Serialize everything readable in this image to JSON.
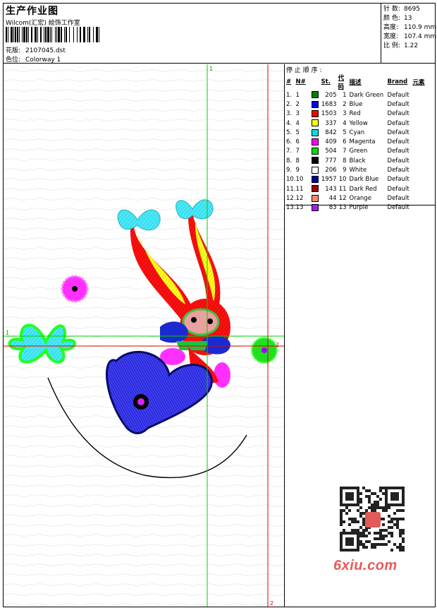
{
  "header": {
    "title": "生产作业图",
    "company": "Wilcom(汇宏) 絵饰工作室",
    "file_label": "花版:",
    "file_name": "2107045.dst",
    "colorway_label": "色位:",
    "colorway_name": "Colorway 1"
  },
  "stats": [
    {
      "label": "针 数:",
      "value": "8695"
    },
    {
      "label": "颜 色:",
      "value": "13"
    },
    {
      "label": "高度:",
      "value": "110.9 mm"
    },
    {
      "label": "宽度:",
      "value": "107.4 mm"
    },
    {
      "label": "比 例:",
      "value": "1.22"
    }
  ],
  "stops": {
    "title": "停 止 顺 序 :",
    "columns": [
      "#",
      "N#",
      "St.",
      "代码",
      "描述",
      "Brand",
      "元素"
    ],
    "rows": [
      {
        "n": "1.",
        "num": "1",
        "color": "#008000",
        "st": "205",
        "code": "1",
        "desc": "Dark Green",
        "brand": "Default"
      },
      {
        "n": "2.",
        "num": "2",
        "color": "#0000ff",
        "st": "1683",
        "code": "2",
        "desc": "Blue",
        "brand": "Default"
      },
      {
        "n": "3.",
        "num": "3",
        "color": "#ff0000",
        "st": "1503",
        "code": "3",
        "desc": "Red",
        "brand": "Default"
      },
      {
        "n": "4.",
        "num": "4",
        "color": "#ffff00",
        "st": "337",
        "code": "4",
        "desc": "Yellow",
        "brand": "Default"
      },
      {
        "n": "5.",
        "num": "5",
        "color": "#00e0e0",
        "st": "842",
        "code": "5",
        "desc": "Cyan",
        "brand": "Default"
      },
      {
        "n": "6.",
        "num": "6",
        "color": "#ff00ff",
        "st": "409",
        "code": "6",
        "desc": "Magenta",
        "brand": "Default"
      },
      {
        "n": "7.",
        "num": "7",
        "color": "#00e000",
        "st": "504",
        "code": "7",
        "desc": "Green",
        "brand": "Default"
      },
      {
        "n": "8.",
        "num": "8",
        "color": "#000000",
        "st": "777",
        "code": "8",
        "desc": "Black",
        "brand": "Default"
      },
      {
        "n": "9.",
        "num": "9",
        "color": "#ffffff",
        "st": "206",
        "code": "9",
        "desc": "White",
        "brand": "Default"
      },
      {
        "n": "10.",
        "num": "10",
        "color": "#0000a0",
        "st": "1957",
        "code": "10",
        "desc": "Dark Blue",
        "brand": "Default"
      },
      {
        "n": "11.",
        "num": "11",
        "color": "#a00000",
        "st": "143",
        "code": "11",
        "desc": "Dark Red",
        "brand": "Default"
      },
      {
        "n": "12.",
        "num": "12",
        "color": "#ff8c70",
        "st": "44",
        "code": "12",
        "desc": "Orange",
        "brand": "Default"
      },
      {
        "n": "13.",
        "num": "13",
        "color": "#a020f0",
        "st": "83",
        "code": "13",
        "desc": "Purple",
        "brand": "Default"
      }
    ]
  },
  "canvas": {
    "guide_labels": {
      "green_v": "1",
      "green_h": "1",
      "red_h": "2",
      "red_v": "2"
    },
    "guide_colors": {
      "green": "#00d000",
      "red": "#e00000"
    }
  },
  "watermark": {
    "site": "6xiu.com"
  }
}
